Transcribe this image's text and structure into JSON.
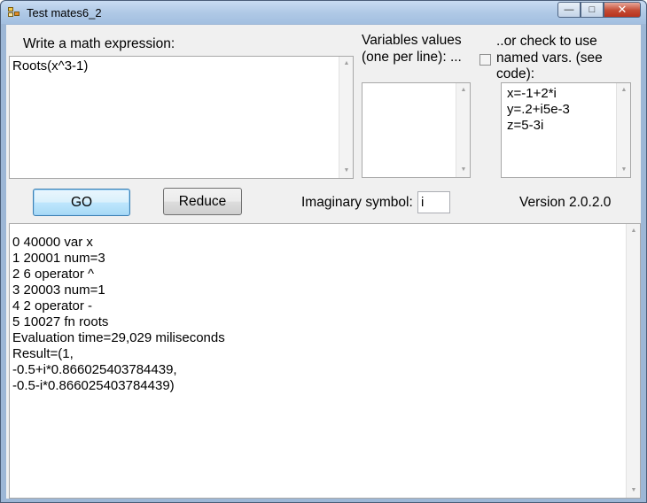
{
  "window": {
    "title": "Test mates6_2"
  },
  "caption": {
    "minimize": "—",
    "maximize": "□",
    "close": "✕"
  },
  "expression": {
    "label": "Write a math expression:",
    "value": "Roots(x^3-1)"
  },
  "variables": {
    "label_line1": "Variables values",
    "label_line2": "(one per line): ...",
    "value": ""
  },
  "named_vars": {
    "label_line1": "..or check to use",
    "label_line2": "named vars. (see",
    "label_line3": "code):",
    "checked": false,
    "value": "x=-1+2*i\ny=.2+i5e-3\nz=5-3i"
  },
  "toolbar": {
    "go_label": "GO",
    "reduce_label": "Reduce",
    "imaginary_label": "Imaginary symbol:",
    "imaginary_value": "i",
    "version": "Version 2.0.2.0"
  },
  "output": {
    "value": "0 40000 var x\n1 20001 num=3\n2 6 operator ^\n3 20003 num=1\n4 2 operator -\n5 10027 fn roots\nEvaluation time=29,029 miliseconds\nResult=(1,\n-0.5+i*0.866025403784439,\n-0.5-i*0.866025403784439)"
  }
}
